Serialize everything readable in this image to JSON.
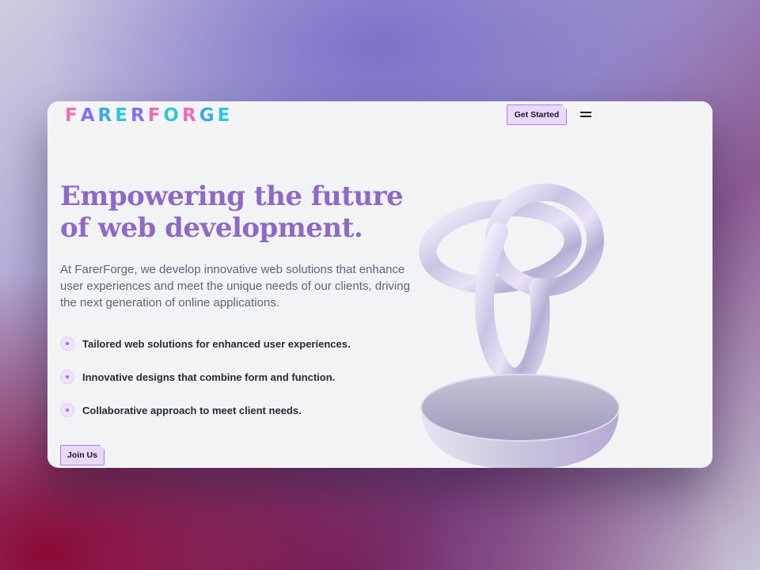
{
  "brand": {
    "logo_text": "FARERFORGE"
  },
  "header": {
    "cta_label": "Get Started",
    "menu_icon": "hamburger-icon"
  },
  "hero": {
    "headline_line1": "Empowering the future",
    "headline_line2": "of web development.",
    "lead": "At FarerForge, we develop innovative web solutions that enhance user experiences and meet the unique needs of our clients, driving the next generation of online applications.",
    "features": [
      "Tailored web solutions for enhanced user experiences.",
      "Innovative designs that combine form and function.",
      "Collaborative approach to meet client needs."
    ],
    "button_label": "Join Us"
  },
  "colors": {
    "accent": "#8e69c6",
    "button_bg": "#e8d9fb",
    "button_border": "#b07be8",
    "card_bg": "#f2f3f5"
  }
}
